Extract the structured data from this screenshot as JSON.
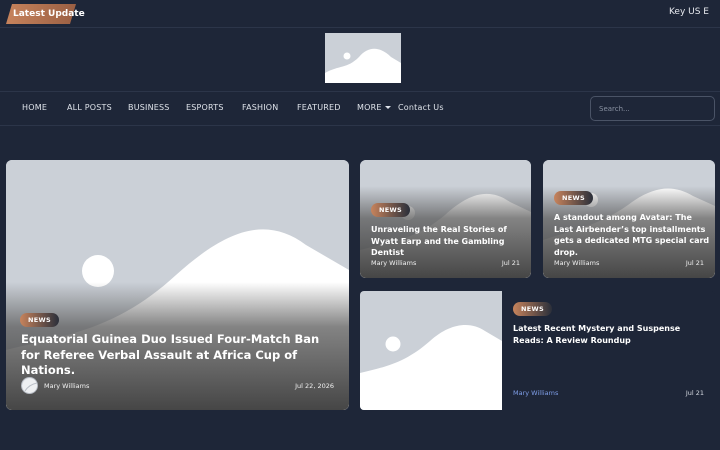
{
  "topbar": {
    "latest_label": "Latest Update",
    "ticker_text": "Key US E"
  },
  "logo": {
    "alt": "site-logo"
  },
  "nav": {
    "items": [
      "HOME",
      "ALL POSTS",
      "BUSINESS",
      "ESPORTS",
      "FASHION",
      "FEATURED",
      "MORE",
      "Contact Us"
    ]
  },
  "search": {
    "placeholder": "Search..."
  },
  "colors": {
    "background": "#1e2638",
    "accent": "#c7835c",
    "author_link": "#7f9ee8"
  },
  "posts": [
    {
      "category": "NEWS",
      "title": "Equatorial Guinea Duo Issued Four-Match Ban for Referee Verbal Assault at Africa Cup of Nations.",
      "author": "Mary Williams",
      "date": "Jul 22, 2026"
    },
    {
      "category": "NEWS",
      "title": "Unraveling the Real Stories of Wyatt Earp and the Gambling Dentist",
      "author": "Mary Williams",
      "date": "Jul 21"
    },
    {
      "category": "NEWS",
      "title": "A standout among Avatar: The Last Airbender’s top installments gets a dedicated MTG special card drop.",
      "author": "Mary Williams",
      "date": "Jul 21"
    },
    {
      "category": "NEWS",
      "title": "Latest Recent Mystery and Suspense Reads: A Review Roundup",
      "author": "Mary Williams",
      "date": "Jul 21"
    }
  ]
}
